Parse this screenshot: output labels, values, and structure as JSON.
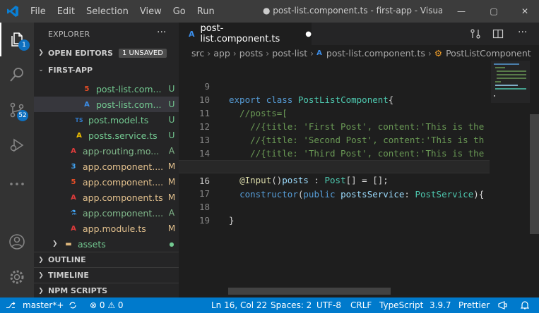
{
  "window": {
    "title": "● post-list.component.ts - first-app - Visual St...",
    "menus": [
      "File",
      "Edit",
      "Selection",
      "View",
      "Go",
      "Run"
    ],
    "controls": [
      "—",
      "▢",
      "✕"
    ]
  },
  "activity": {
    "explorer_badge": "1",
    "scm_badge": "52"
  },
  "sidebar": {
    "header": "EXPLORER",
    "more": "···",
    "open_editors": "OPEN EDITORS",
    "unsaved": "1 UNSAVED",
    "project": "FIRST-APP",
    "files": [
      {
        "name": "post-list.com...",
        "status": "U",
        "icon": "html-icon",
        "glyph": "5"
      },
      {
        "name": "post-list.com...",
        "status": "U",
        "icon": "angular-icon",
        "glyph": "A"
      },
      {
        "name": "post.model.ts",
        "status": "U",
        "icon": "typescript-icon",
        "glyph": "TS"
      },
      {
        "name": "posts.service.ts",
        "status": "U",
        "icon": "service-icon",
        "glyph": "A"
      },
      {
        "name": "app-routing.mo...",
        "status": "A",
        "icon": "angular-icon",
        "glyph": "A"
      },
      {
        "name": "app.component....",
        "status": "M",
        "icon": "css-icon",
        "glyph": "3"
      },
      {
        "name": "app.component....",
        "status": "M",
        "icon": "html-icon",
        "glyph": "5"
      },
      {
        "name": "app.component.ts",
        "status": "M",
        "icon": "angular-icon",
        "glyph": "A"
      },
      {
        "name": "app.component....",
        "status": "A",
        "icon": "flask-icon",
        "glyph": "⚗"
      },
      {
        "name": "app.module.ts",
        "status": "M",
        "icon": "angular-icon",
        "glyph": "A"
      },
      {
        "name": "assets",
        "status": "●",
        "icon": "folder-icon",
        "glyph": "▬"
      }
    ],
    "outline": "OUTLINE",
    "timeline": "TIMELINE",
    "npm": "NPM SCRIPTS"
  },
  "editor": {
    "tab_label": "post-list.component.ts",
    "breadcrumb": [
      "src",
      "app",
      "posts",
      "post-list",
      "post-list.component.ts",
      "PostListComponent"
    ],
    "lines": [
      {
        "n": "9",
        "text": "export class PostListComponent{"
      },
      {
        "n": "10",
        "text": "  //posts=["
      },
      {
        "n": "11",
        "text": "    //{title: 'First Post', content:'This is the"
      },
      {
        "n": "12",
        "text": "    //{title: 'Second Post', content:'This is th"
      },
      {
        "n": "13",
        "text": "    //{title: 'Third Post', content:'This is the"
      },
      {
        "n": "14",
        "text": "  //];"
      },
      {
        "n": "15",
        "text": "  @Input()posts : Post[] = [];"
      },
      {
        "n": "16",
        "text": "  constructor(public postsService: PostService){"
      },
      {
        "n": "17",
        "text": ""
      },
      {
        "n": "18",
        "text": "}"
      },
      {
        "n": "19",
        "text": ""
      }
    ]
  },
  "status": {
    "branch": "master*+",
    "problems": "⊗ 0 ⚠ 0",
    "position": "Ln 16, Col 22",
    "spaces": "Spaces: 2",
    "encoding": "UTF-8",
    "eol": "CRLF",
    "language": "TypeScript",
    "version": "3.9.7",
    "formatter": "Prettier"
  },
  "colors": {
    "accent": "#007acc",
    "keyword": "#569cd6",
    "type": "#4ec9b0",
    "comment": "#6a9955",
    "untracked": "#73c991",
    "modified": "#e2c08d"
  }
}
